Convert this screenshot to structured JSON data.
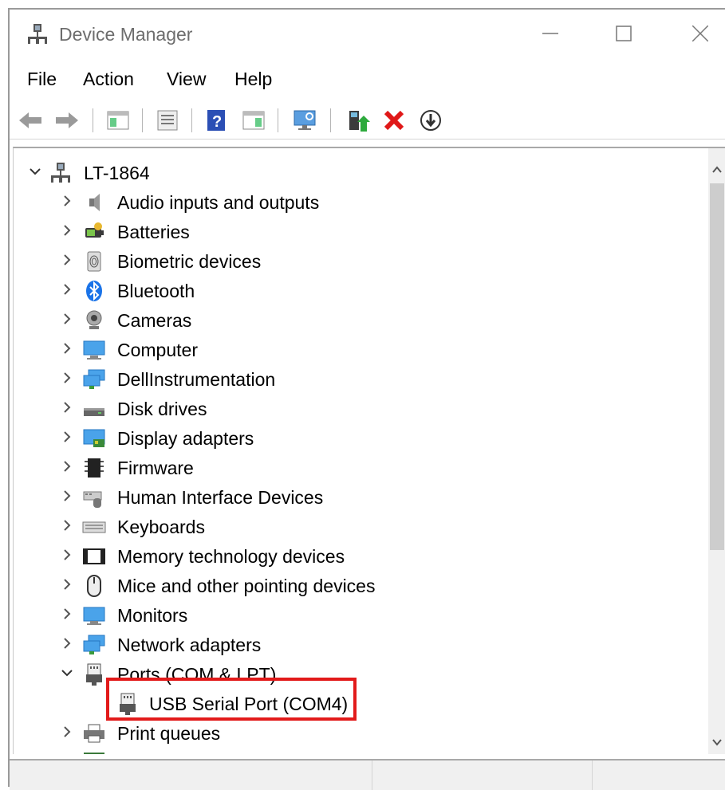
{
  "window": {
    "title": "Device Manager"
  },
  "menu": [
    "File",
    "Action",
    "View",
    "Help"
  ],
  "toolbar": {
    "buttons": [
      "back-icon",
      "forward-icon",
      "show-hide-console-tree-icon",
      "properties-icon",
      "help-icon",
      "action-pane-icon",
      "scan-hardware-icon",
      "update-driver-icon",
      "uninstall-icon",
      "enable-device-icon"
    ]
  },
  "tree": {
    "root": "LT-1864",
    "items": [
      {
        "label": "Audio inputs and outputs",
        "icon": "speaker-icon"
      },
      {
        "label": "Batteries",
        "icon": "battery-icon"
      },
      {
        "label": "Biometric devices",
        "icon": "fingerprint-icon"
      },
      {
        "label": "Bluetooth",
        "icon": "bluetooth-icon"
      },
      {
        "label": "Cameras",
        "icon": "camera-icon"
      },
      {
        "label": "Computer",
        "icon": "computer-icon"
      },
      {
        "label": "DellInstrumentation",
        "icon": "network-computer-icon"
      },
      {
        "label": "Disk drives",
        "icon": "disk-drive-icon"
      },
      {
        "label": "Display adapters",
        "icon": "display-adapter-icon"
      },
      {
        "label": "Firmware",
        "icon": "chip-icon"
      },
      {
        "label": "Human Interface Devices",
        "icon": "hid-icon"
      },
      {
        "label": "Keyboards",
        "icon": "keyboard-icon"
      },
      {
        "label": "Memory technology devices",
        "icon": "memory-icon"
      },
      {
        "label": "Mice and other pointing devices",
        "icon": "mouse-icon"
      },
      {
        "label": "Monitors",
        "icon": "monitor-icon"
      },
      {
        "label": "Network adapters",
        "icon": "network-adapter-icon"
      },
      {
        "label": "Ports (COM & LPT)",
        "icon": "port-icon",
        "expanded": true
      },
      {
        "label": "USB Serial Port (COM4)",
        "icon": "port-icon",
        "child": true,
        "highlighted": true
      },
      {
        "label": "Print queues",
        "icon": "printer-icon"
      }
    ]
  },
  "colors": {
    "highlight": "#e21a1a",
    "title_text": "#6d6d6d"
  }
}
